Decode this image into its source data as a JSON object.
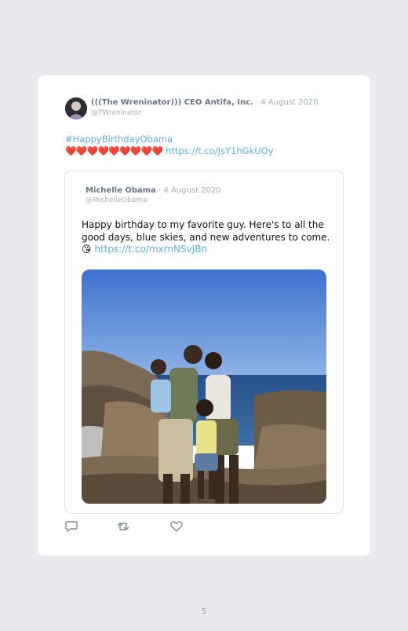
{
  "tweet": {
    "display_name": "(((The Wreninator))) CEO Antifa, Inc.",
    "separator": " · ",
    "date": "4 August 2020",
    "handle": "@TWreninator",
    "hashtag": "#HappyBirthdayObama",
    "hearts": "❤️❤️❤️❤️❤️❤️❤️❤️❤️",
    "link": "https://t.co/JsY1hGkUOy"
  },
  "quoted_tweet": {
    "display_name": "Michelle Obama",
    "separator": " · ",
    "date": "4 August 2020",
    "handle": "@MichelleObama",
    "text": "Happy birthday to my favorite guy. Here's to all the good days, blue skies, and new adventures to come.",
    "emoji": "😘",
    "link": "https://t.co/mxrnNSvJBn"
  },
  "actions": {
    "reply_icon": "reply-icon",
    "retweet_icon": "retweet-icon",
    "like_icon": "heart-icon"
  },
  "page_number": "5",
  "colors": {
    "page_background": "#e8eaee",
    "link": "#5bb0e6",
    "muted": "#a3adb8",
    "name": "#6a7685",
    "heart": "#e0245e"
  }
}
